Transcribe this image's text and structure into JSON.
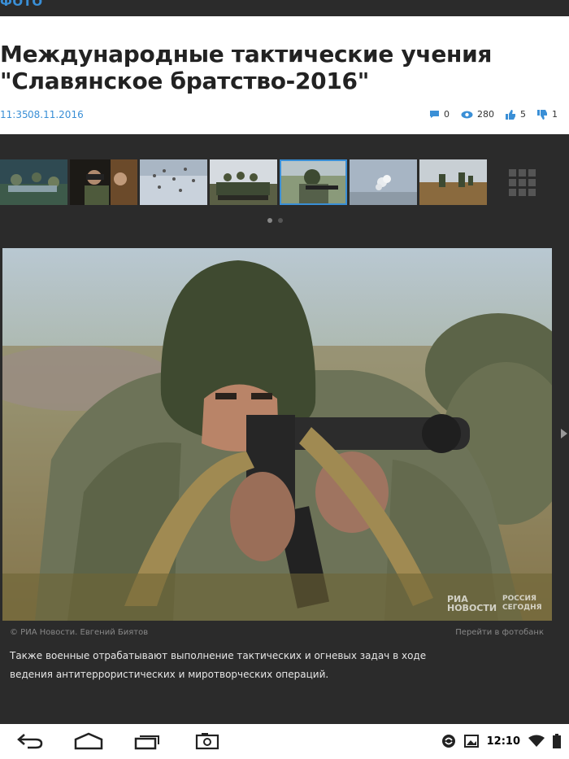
{
  "topbar": {
    "section_label": "ФОТО"
  },
  "article": {
    "title_line1": "Международные тактические учения",
    "title_line2": "\"Славянское братство-2016\"",
    "time": "11:35",
    "date": "08.11.2016",
    "stats": {
      "comments": "0",
      "views": "280",
      "likes": "5",
      "dislikes": "1"
    }
  },
  "gallery": {
    "thumbnail_count": 7,
    "active_thumbnail": 5,
    "pages": 2,
    "current_page": 1,
    "watermark_brand": "РИА НОВОСТИ",
    "watermark_partner": "РОССИЯ СЕГОДНЯ",
    "credit": "© РИА Новости. Евгений Биятов",
    "photobank_link": "Перейти в фотобанк",
    "caption": "Также военные отрабатывают выполнение тактических и огневых задач в ходе ведения антитеррористических и миротворческих операций."
  },
  "system_bar": {
    "clock": "12:10",
    "nav": [
      "back-icon",
      "home-icon",
      "recent-apps-icon",
      "screenshot-icon"
    ],
    "status_icons": [
      "sync-icon",
      "gallery-notification-icon",
      "wifi-icon",
      "battery-icon"
    ]
  },
  "colors": {
    "accent": "#3a8fd6",
    "background": "#2b2b2b"
  }
}
